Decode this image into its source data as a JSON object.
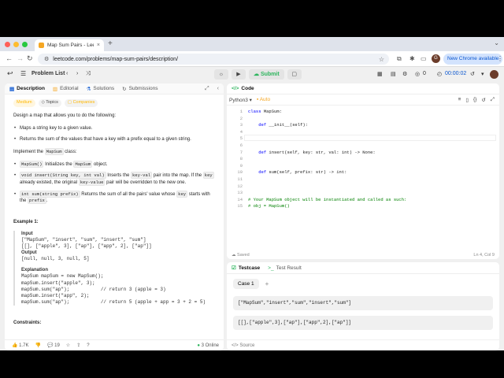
{
  "browser": {
    "tab_title": "Map Sum Pairs - LeetCode",
    "tab_close": "×",
    "new_tab": "+",
    "tab_menu": "⌄",
    "url": "leetcode.com/problems/map-sum-pairs/description/",
    "profile_initial": "G",
    "new_chrome": "New Chrome available"
  },
  "lc_nav": {
    "problem_list": "Problem List",
    "submit": "Submit",
    "streak": "0",
    "timer": "00:00:02"
  },
  "left_panel": {
    "tabs": [
      "Description",
      "Editorial",
      "Solutions",
      "Submissions"
    ],
    "chips": [
      "Medium",
      "Topics",
      "Companies"
    ],
    "intro": "Design a map that allows you to do the following:",
    "bullets1": [
      "Maps a string key to a given value.",
      "Returns the sum of the values that have a key with a prefix equal to a given string."
    ],
    "implement_pre": "Implement the ",
    "implement_code": "MapSum",
    "implement_post": " class:",
    "m1_code": "MapSum()",
    "m1_text": " Initializes the ",
    "m1_code2": "MapSum",
    "m1_end": " object.",
    "m2_code": "void insert(String key, int val)",
    "m2_t1": " Inserts the ",
    "m2_c2": "key-val",
    "m2_t2": " pair into the map. If the ",
    "m2_c3": "key",
    "m2_t3": " already existed, the original ",
    "m2_c4": "key-value",
    "m2_t4": " pair will be overridden to the new one.",
    "m3_code": "int sum(string prefix)",
    "m3_t1": " Returns the sum of all the pairs' value whose ",
    "m3_c2": "key",
    "m3_t2": " starts with the ",
    "m3_c3": "prefix",
    "m3_t3": ".",
    "example_title": "Example 1:",
    "input_label": "Input",
    "input_l1": "[\"MapSum\", \"insert\", \"sum\", \"insert\", \"sum\"]",
    "input_l2": "[[], [\"apple\", 3], [\"ap\"], [\"app\", 2], [\"ap\"]]",
    "output_label": "Output",
    "output_l1": "[null, null, 3, null, 5]",
    "expl_label": "Explanation",
    "expl_lines": [
      "MapSum mapSum = new MapSum();",
      "mapSum.insert(\"apple\", 3);",
      "mapSum.sum(\"ap\");           // return 3 (apple = 3)",
      "mapSum.insert(\"app\", 2);",
      "mapSum.sum(\"ap\");           // return 5 (apple + app = 3 + 2 = 5)"
    ],
    "constraints": "Constraints:",
    "likes": "1.7K",
    "comments": "19",
    "online": "3 Online"
  },
  "code_panel": {
    "title": "Code",
    "language": "Python3",
    "auto": "Auto",
    "lines": [
      "class MapSum:",
      "",
      "    def __init__(self):",
      "",
      "",
      "",
      "    def insert(self, key: str, val: int) -> None:",
      "",
      "",
      "    def sum(self, prefix: str) -> int:",
      "",
      "",
      "",
      "# Your MapSum object will be instantiated and called as such:",
      "# obj = MapSum()"
    ],
    "saved": "Saved",
    "cursor_pos": "Ln 4, Col 9"
  },
  "test_panel": {
    "tabs": [
      "Testcase",
      "Test Result"
    ],
    "case_label": "Case 1",
    "add": "+",
    "input1": "[\"MapSum\",\"insert\",\"sum\",\"insert\",\"sum\"]",
    "input2": "[[],[\"apple\",3],[\"ap\"],[\"app\",2],[\"ap\"]]",
    "source": "Source"
  },
  "colors": {
    "accent_green": "#2db55d",
    "medium": "#ffb800",
    "python_keyword": "#0000ff",
    "comment": "#008000"
  }
}
